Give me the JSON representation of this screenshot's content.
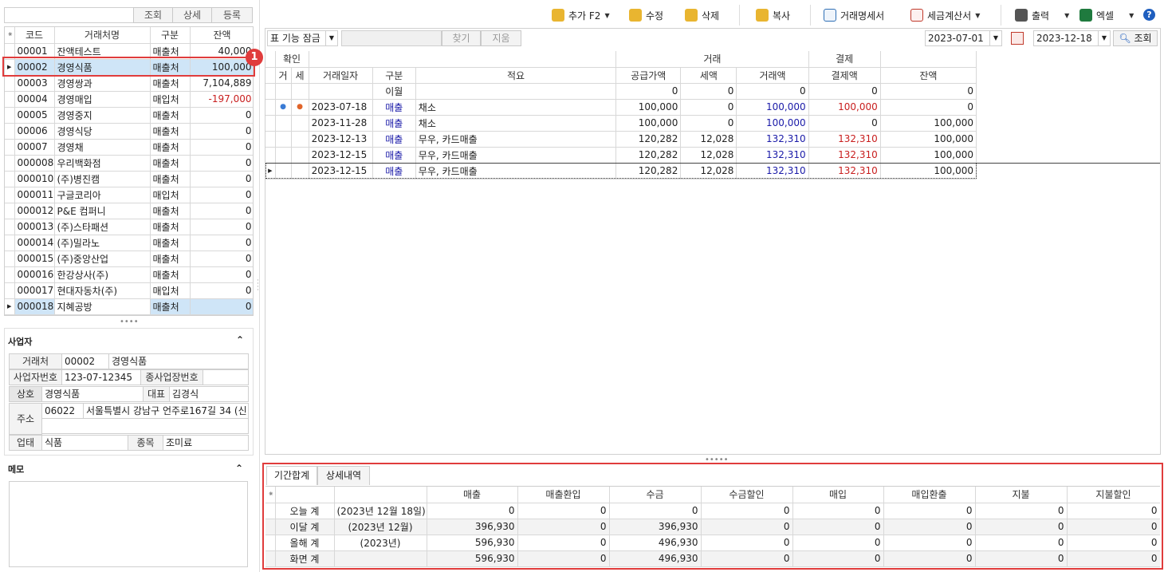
{
  "left": {
    "search_placeholder": "",
    "btn_search": "조회",
    "btn_detail": "상세",
    "btn_register": "등록",
    "columns": [
      "코드",
      "거래처명",
      "구분",
      "잔액"
    ],
    "rows": [
      {
        "code": "00001",
        "name": "잔액테스트",
        "type": "매출처",
        "bal": "40,000",
        "cls": ""
      },
      {
        "code": "00002",
        "name": "경영식품",
        "type": "매출처",
        "bal": "100,000",
        "cls": "sel"
      },
      {
        "code": "00003",
        "name": "경영쌍과",
        "type": "매출처",
        "bal": "7,104,889",
        "cls": ""
      },
      {
        "code": "00004",
        "name": "경영매입",
        "type": "매입처",
        "bal": "-197,000",
        "cls": "neg"
      },
      {
        "code": "00005",
        "name": "경영중지",
        "type": "매출처",
        "bal": "0",
        "cls": ""
      },
      {
        "code": "00006",
        "name": "경영식당",
        "type": "매출처",
        "bal": "0",
        "cls": ""
      },
      {
        "code": "00007",
        "name": "경영채",
        "type": "매출처",
        "bal": "0",
        "cls": ""
      },
      {
        "code": "000008",
        "name": "우리백화점",
        "type": "매출처",
        "bal": "0",
        "cls": ""
      },
      {
        "code": "000010",
        "name": "(주)병진캠",
        "type": "매출처",
        "bal": "0",
        "cls": ""
      },
      {
        "code": "000011",
        "name": "구글코리아",
        "type": "매입처",
        "bal": "0",
        "cls": ""
      },
      {
        "code": "000012",
        "name": "P&E 컴퍼니",
        "type": "매출처",
        "bal": "0",
        "cls": ""
      },
      {
        "code": "000013",
        "name": "(주)스타패션",
        "type": "매출처",
        "bal": "0",
        "cls": ""
      },
      {
        "code": "000014",
        "name": "(주)밀라노",
        "type": "매출처",
        "bal": "0",
        "cls": ""
      },
      {
        "code": "000015",
        "name": "(주)중앙산업",
        "type": "매출처",
        "bal": "0",
        "cls": ""
      },
      {
        "code": "000016",
        "name": "한강상사(주)",
        "type": "매출처",
        "bal": "0",
        "cls": ""
      },
      {
        "code": "000017",
        "name": "현대자동차(주)",
        "type": "매입처",
        "bal": "0",
        "cls": ""
      },
      {
        "code": "000018",
        "name": "지혜공방",
        "type": "매출처",
        "bal": "0",
        "cls": "sel2"
      }
    ]
  },
  "badge": "1",
  "business": {
    "title": "사업자",
    "lbl_partner": "거래처",
    "partner_code": "00002",
    "partner_name": "경영식품",
    "lbl_bizno": "사업자번호",
    "bizno": "123-07-12345",
    "lbl_subbiz": "종사업장번호",
    "subbiz": "",
    "lbl_company": "상호",
    "company": "경영식품",
    "lbl_ceo": "대표",
    "ceo": "김경식",
    "lbl_addr": "주소",
    "zip": "06022",
    "addr": "서울특별시 강남구 언주로167길 34 (신",
    "lbl_biztype": "업태",
    "biztype": "식품",
    "lbl_item": "종목",
    "item": "조미료"
  },
  "memo": {
    "title": "메모"
  },
  "toolbar": {
    "add": "추가 F2",
    "edit": "수정",
    "delete": "삭제",
    "copy": "복사",
    "statement": "거래명세서",
    "tax": "세금계산서",
    "print": "출력",
    "excel": "엑셀"
  },
  "filter": {
    "lock": "표 기능 잠금",
    "find": "찾기",
    "clear": "지움",
    "date_from": "2023-07-01",
    "date_to": "2023-12-18",
    "search": "조회"
  },
  "main": {
    "group_confirm": "확인",
    "group_trade": "거래",
    "group_settle": "결제",
    "columns": [
      "거",
      "세",
      "거래일자",
      "구분",
      "적요",
      "공급가액",
      "세액",
      "거래액",
      "결제액",
      "잔액"
    ],
    "carry_row": {
      "type": "이월",
      "supply": "0",
      "tax": "0",
      "amount": "0",
      "settle": "0",
      "balance": "0"
    },
    "rows": [
      {
        "g": "●",
        "s": "●",
        "date": "2023-07-18",
        "type": "매출",
        "memo": "채소",
        "supply": "100,000",
        "tax": "0",
        "amount": "100,000",
        "settle": "100,000",
        "balance": "0"
      },
      {
        "g": "",
        "s": "",
        "date": "2023-11-28",
        "type": "매출",
        "memo": "채소",
        "supply": "100,000",
        "tax": "0",
        "amount": "100,000",
        "settle": "0",
        "balance": "100,000"
      },
      {
        "g": "",
        "s": "",
        "date": "2023-12-13",
        "type": "매출",
        "memo": "무우, 카드매출",
        "supply": "120,282",
        "tax": "12,028",
        "amount": "132,310",
        "settle": "132,310",
        "balance": "100,000"
      },
      {
        "g": "",
        "s": "",
        "date": "2023-12-15",
        "type": "매출",
        "memo": "무우, 카드매출",
        "supply": "120,282",
        "tax": "12,028",
        "amount": "132,310",
        "settle": "132,310",
        "balance": "100,000"
      },
      {
        "g": "",
        "s": "",
        "date": "2023-12-15",
        "type": "매출",
        "memo": "무우, 카드매출",
        "supply": "120,282",
        "tax": "12,028",
        "amount": "132,310",
        "settle": "132,310",
        "balance": "100,000"
      }
    ]
  },
  "summary": {
    "tab_period": "기간합계",
    "tab_detail": "상세내역",
    "columns": [
      "매출",
      "매출환입",
      "수금",
      "수금할인",
      "매입",
      "매입환출",
      "지불",
      "지불할인"
    ],
    "rows": [
      {
        "label": "오늘 계",
        "period": "(2023년 12월 18일)",
        "v": [
          "0",
          "0",
          "0",
          "0",
          "0",
          "0",
          "0",
          "0"
        ]
      },
      {
        "label": "이달 계",
        "period": "(2023년 12월)",
        "v": [
          "396,930",
          "0",
          "396,930",
          "0",
          "0",
          "0",
          "0",
          "0"
        ]
      },
      {
        "label": "올해 계",
        "period": "(2023년)",
        "v": [
          "596,930",
          "0",
          "496,930",
          "0",
          "0",
          "0",
          "0",
          "0"
        ]
      },
      {
        "label": "화면 계",
        "period": "",
        "v": [
          "596,930",
          "0",
          "496,930",
          "0",
          "0",
          "0",
          "0",
          "0"
        ]
      }
    ]
  }
}
